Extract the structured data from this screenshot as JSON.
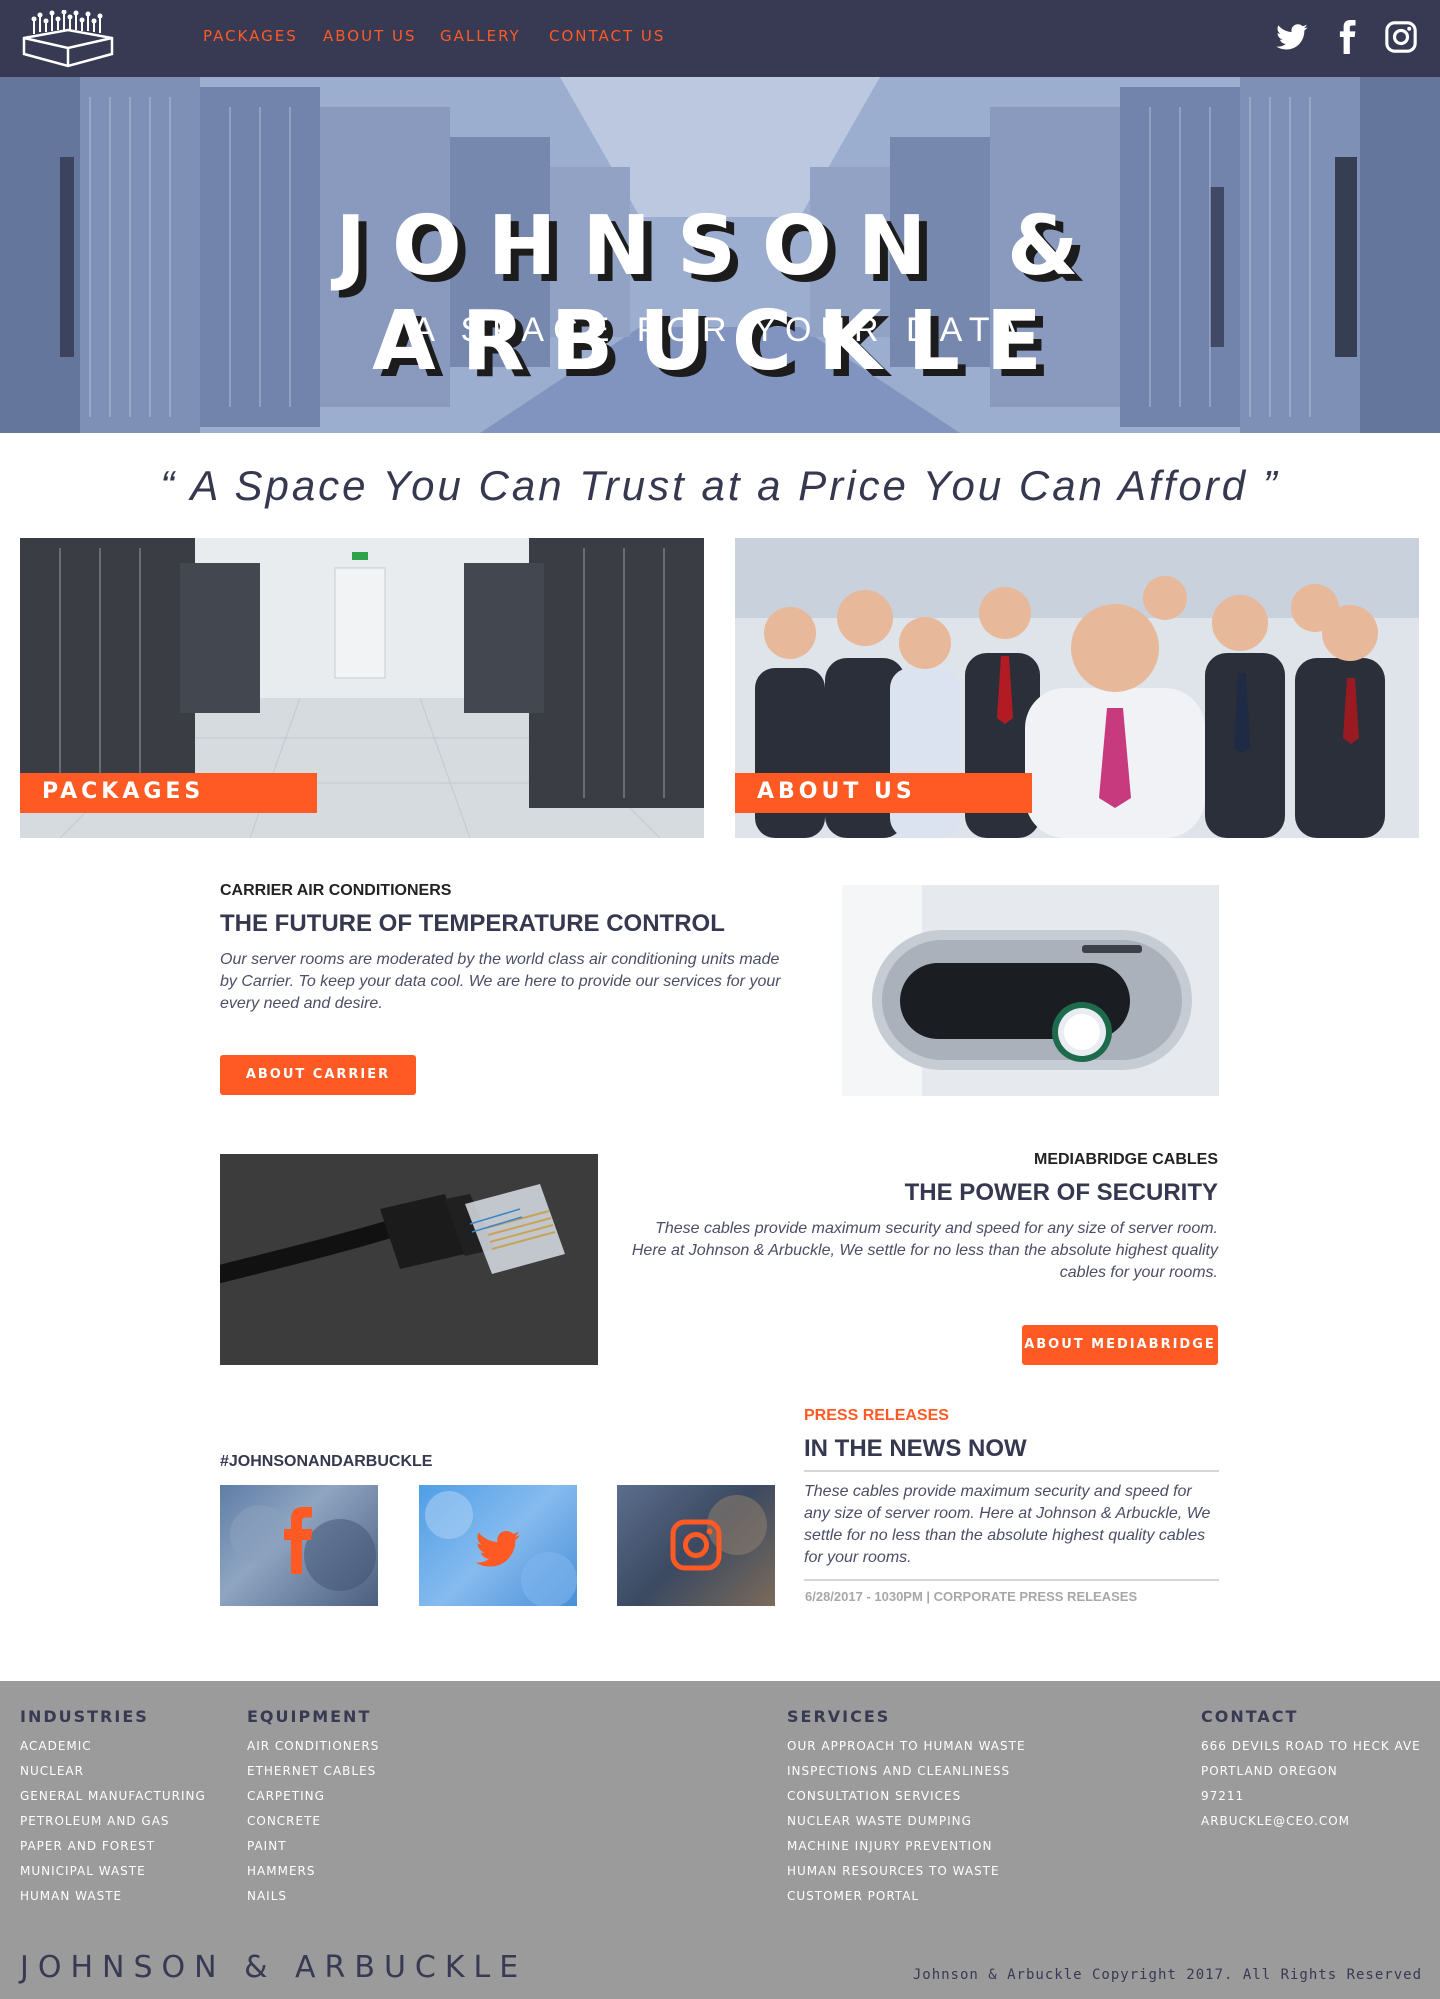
{
  "brand": {
    "name": "JOHNSON & ARBUCKLE"
  },
  "nav": {
    "links": [
      "PACKAGES",
      "ABOUT US",
      "GALLERY",
      "CONTACT US"
    ]
  },
  "hero": {
    "title": "JOHNSON & ARBUCKLE",
    "subtitle": "A SPACE FOR YOUR DATA"
  },
  "quote": "“ A Space You Can Trust at a Price You Can Afford ”",
  "tiles": [
    {
      "label": "PACKAGES"
    },
    {
      "label": "ABOUT US"
    }
  ],
  "carrier": {
    "eyebrow": "CARRIER AIR CONDITIONERS",
    "heading": "THE FUTURE OF TEMPERATURE CONTROL",
    "body": "Our server rooms are moderated by the world class air conditioning units made by Carrier. To keep your data cool. We are here to provide our services for your every need and desire.",
    "button": "ABOUT CARRIER"
  },
  "mediabridge": {
    "eyebrow": "MEDIABRIDGE CABLES",
    "heading": "THE POWER OF SECURITY",
    "body": "These cables provide maximum security and speed for any size of server room. Here at Johnson & Arbuckle, We settle for no less than the absolute highest quality cables for your rooms.",
    "button": "ABOUT MEDIABRIDGE"
  },
  "social_feed": {
    "hashtag": "#JOHNSONANDARBUCKLE"
  },
  "press": {
    "eyebrow": "PRESS RELEASES",
    "heading": "IN THE NEWS NOW",
    "body": "These cables provide maximum security and speed for any size of server room. Here at Johnson & Arbuckle, We settle for no less than the absolute highest quality cables for your rooms.",
    "meta": "6/28/2017 - 1030PM | CORPORATE PRESS RELEASES"
  },
  "footer": {
    "industries": {
      "title": "INDUSTRIES",
      "items": [
        "ACADEMIC",
        "NUCLEAR",
        "GENERAL MANUFACTURING",
        "PETROLEUM AND GAS",
        "PAPER AND FOREST",
        "MUNICIPAL WASTE",
        "HUMAN WASTE"
      ]
    },
    "equipment": {
      "title": "EQUIPMENT",
      "items": [
        "AIR CONDITIONERS",
        "ETHERNET CABLES",
        "CARPETING",
        "CONCRETE",
        "PAINT",
        "HAMMERS",
        "NAILS"
      ]
    },
    "services": {
      "title": "SERVICES",
      "items": [
        "OUR APPROACH TO HUMAN WASTE",
        "INSPECTIONS AND CLEANLINESS",
        "CONSULTATION SERVICES",
        "NUCLEAR WASTE DUMPING",
        "MACHINE INJURY PREVENTION",
        "HUMAN RESOURCES TO WASTE",
        "CUSTOMER PORTAL"
      ]
    },
    "contact": {
      "title": "CONTACT",
      "items": [
        "666 DEVILS ROAD TO HECK AVE",
        "PORTLAND OREGON",
        "97211",
        "ARBUCKLE@CEO.COM"
      ]
    },
    "brand": "JOHNSON & ARBUCKLE",
    "copyright": "Johnson & Arbuckle Copyright 2017. All Rights Reserved"
  },
  "colors": {
    "nav_bg": "#383953",
    "accent": "#ff5a24",
    "footer_bg": "#9b9b9b",
    "heading": "#36384f"
  },
  "icons": [
    "logo-icon",
    "twitter-icon",
    "facebook-icon",
    "instagram-icon"
  ]
}
